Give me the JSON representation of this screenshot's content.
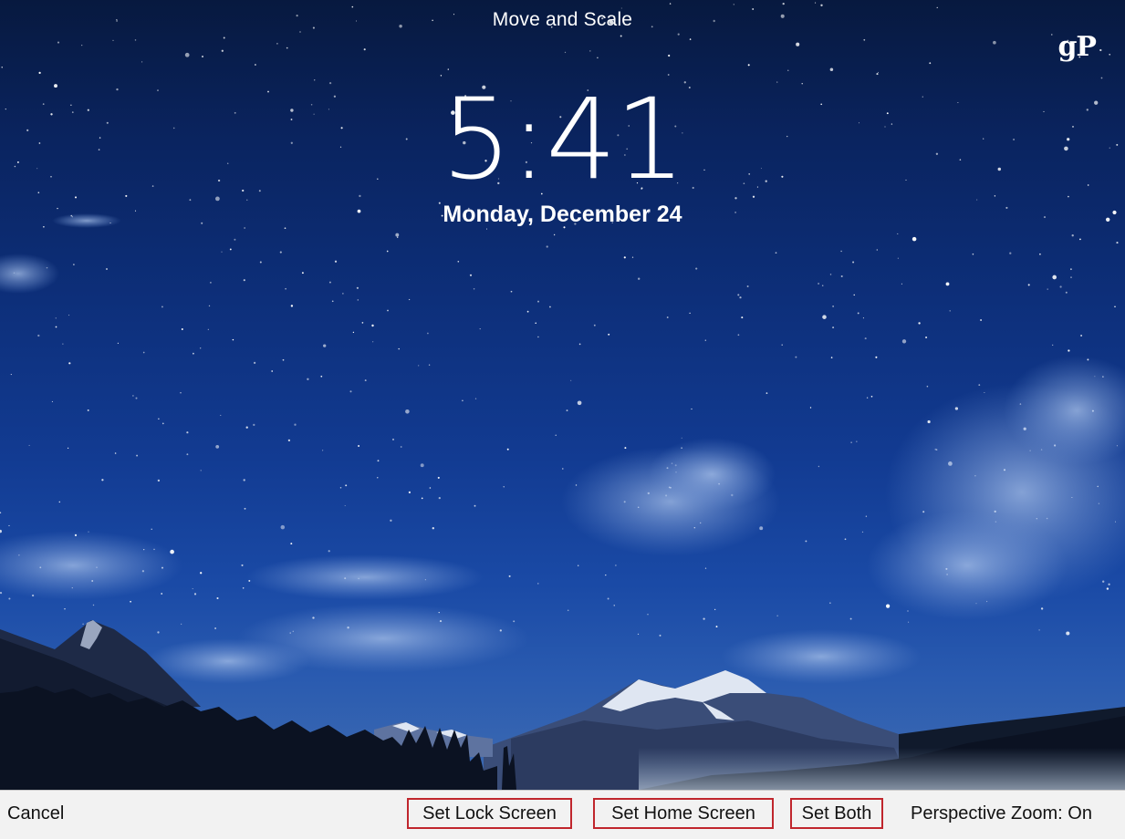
{
  "header": {
    "title": "Move and Scale",
    "logo_text": "gP"
  },
  "lockscreen": {
    "time": "5:41",
    "date": "Monday, December 24"
  },
  "toolbar": {
    "cancel_label": "Cancel",
    "set_lock_label": "Set Lock Screen",
    "set_home_label": "Set Home Screen",
    "set_both_label": "Set Both",
    "perspective_label": "Perspective Zoom: On"
  },
  "colors": {
    "sky_top": "#07193f",
    "sky_bottom": "#3f6cb2",
    "toolbar_bg": "#f2f2f2",
    "highlight_box": "#c0262d"
  }
}
